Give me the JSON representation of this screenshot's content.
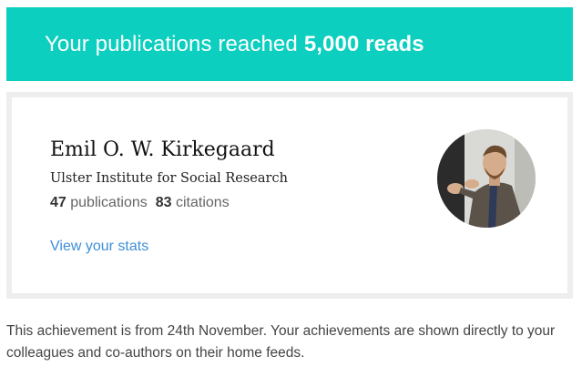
{
  "banner": {
    "text_prefix": "Your publications reached",
    "text_bold": "5,000 reads"
  },
  "profile": {
    "name": "Emil O. W. Kirkegaard",
    "institution": "Ulster Institute for Social Research",
    "publications_count": "47",
    "publications_label": "publications",
    "citations_count": "83",
    "citations_label": "citations",
    "stats_link": "View your stats"
  },
  "footer": {
    "text": "This achievement is from 24th November. Your achievements are shown directly to your colleagues and co-authors on their home feeds."
  },
  "colors": {
    "banner_bg": "#0ccfbf",
    "link": "#3d8fd8"
  }
}
